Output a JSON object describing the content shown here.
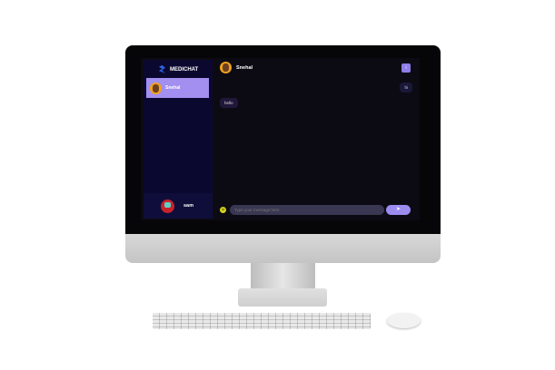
{
  "app": {
    "name": "MEDICHAT"
  },
  "sidebar": {
    "contacts": [
      {
        "name": "Snehal"
      }
    ],
    "current_user": "sam"
  },
  "chat": {
    "contact_name": "Snehal",
    "info_icon": "i",
    "messages": [
      {
        "direction": "outgoing",
        "text": "hi"
      },
      {
        "direction": "incoming",
        "text": "hello"
      }
    ],
    "input_placeholder": "Type your message here",
    "send_icon": "➤",
    "emoji_icon": "☺"
  },
  "colors": {
    "accent": "#a28ff0",
    "sidebar": "#0b0830",
    "chat_bg": "#0c0b14"
  }
}
